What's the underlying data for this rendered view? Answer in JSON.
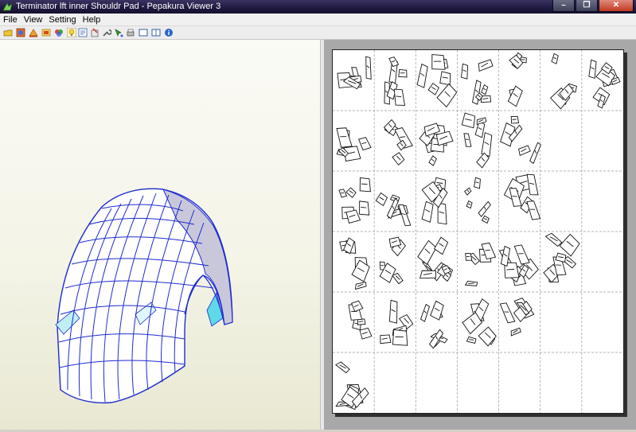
{
  "window": {
    "title": "Terminator lft inner Shouldr Pad - Pepakura Viewer 3",
    "controls": {
      "minimize": "–",
      "restore": "❐",
      "close": "✕"
    }
  },
  "menu": {
    "items": [
      "File",
      "View",
      "Setting",
      "Help"
    ]
  },
  "toolbar": {
    "buttons": [
      "open-icon",
      "3d-model-icon",
      "unfold-icon",
      "texture-icon",
      "color-icon",
      "light-bulb-icon",
      "page-icon",
      "settings-icon",
      "wrench-icon",
      "select-icon",
      "print-icon",
      "layout-single-icon",
      "layout-split-icon",
      "info-icon"
    ]
  },
  "colors": {
    "mesh_edge": "#1f2bd0",
    "mesh_fill": "#ffffff",
    "mesh_shade": "#c7c7d8",
    "highlight": "#34d3e8",
    "page_bg": "#a8a8a8"
  },
  "sheet": {
    "columns": 7,
    "rows": 6
  }
}
